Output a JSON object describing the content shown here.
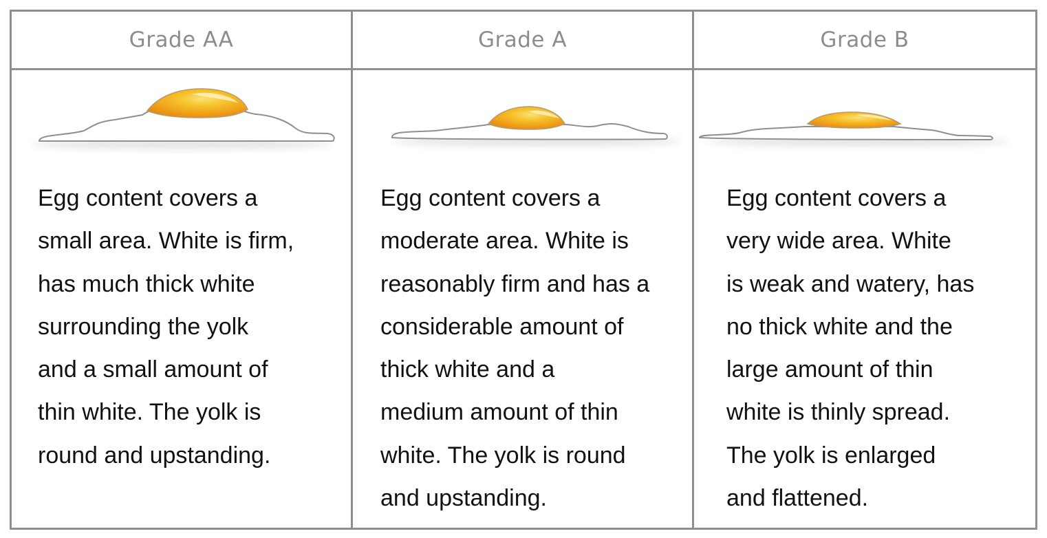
{
  "grades": [
    {
      "label": "Grade AA",
      "lines": [
        "Egg content covers a",
        "small area. White is firm,",
        "has much thick white",
        "surrounding the yolk",
        "and a small amount of",
        "thin white. The yolk is",
        "round and upstanding."
      ]
    },
    {
      "label": "Grade A",
      "lines": [
        "Egg content covers a",
        "moderate area. White is",
        "reasonably firm and has a",
        "considerable amount of",
        "thick white and a",
        "medium amount of thin",
        "white. The yolk is round",
        "and upstanding."
      ]
    },
    {
      "label": "Grade B",
      "lines": [
        "Egg content covers a",
        "very wide area. White",
        "is weak and watery, has",
        "no thick white and the",
        "large amount of thin",
        "white is thinly spread.",
        "The yolk is enlarged",
        "and flattened."
      ]
    }
  ],
  "colors": {
    "border": "#918f8a",
    "header_text": "#8e8c88",
    "body_text": "#111111",
    "yolk_center": "#f7c22a",
    "yolk_edge": "#e8860f",
    "egg_outline": "#8f8f8f"
  }
}
